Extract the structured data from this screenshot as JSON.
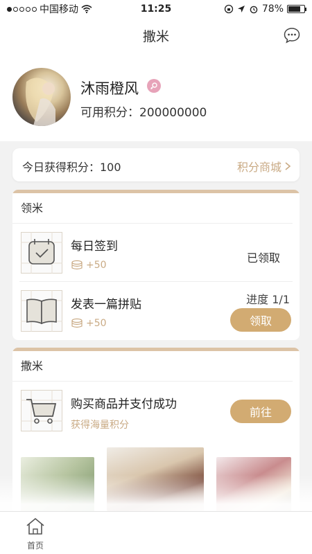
{
  "status": {
    "carrier": "中国移动",
    "time": "11:25",
    "battery": "78%",
    "battery_level": 0.78
  },
  "nav": {
    "title": "撒米",
    "chat_icon": "chat-bubble-icon"
  },
  "profile": {
    "username": "沐雨橙风",
    "points_label": "可用积分：",
    "points_value": "200000000"
  },
  "today": {
    "label": "今日获得积分：100",
    "mall_link": "积分商城"
  },
  "lingmi": {
    "title": "领米",
    "tasks": [
      {
        "name": "每日签到",
        "reward": "+50",
        "status": "已领取"
      },
      {
        "name": "发表一篇拼贴",
        "reward": "+50",
        "progress": "进度  1/1",
        "button": "领取"
      }
    ]
  },
  "samie": {
    "title": "撒米",
    "tasks": [
      {
        "name": "购买商品并支付成功",
        "reward": "获得海量积分",
        "button": "前往"
      }
    ]
  },
  "tabbar": {
    "home_label": "首页"
  },
  "colors": {
    "accent": "#d2ab72",
    "accent_text": "#c9aa84",
    "card_bar": "#dcc3a6"
  }
}
